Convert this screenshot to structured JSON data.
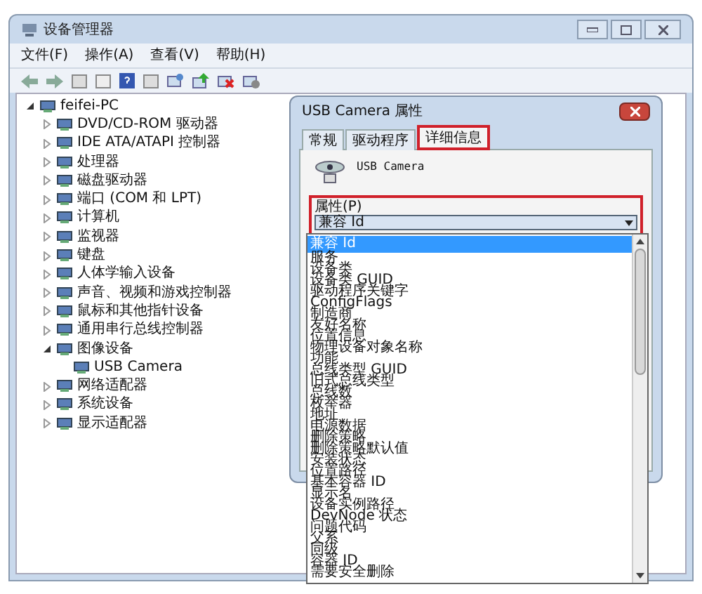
{
  "window": {
    "title": "设备管理器"
  },
  "menu": [
    {
      "label": "文件(F)"
    },
    {
      "label": "操作(A)"
    },
    {
      "label": "查看(V)"
    },
    {
      "label": "帮助(H)"
    }
  ],
  "tree": {
    "label": "feifei-PC",
    "expanded": true,
    "children": [
      {
        "label": "DVD/CD-ROM 驱动器",
        "expanded": false
      },
      {
        "label": "IDE ATA/ATAPI 控制器",
        "expanded": false
      },
      {
        "label": "处理器",
        "expanded": false
      },
      {
        "label": "磁盘驱动器",
        "expanded": false
      },
      {
        "label": "端口 (COM 和 LPT)",
        "expanded": false
      },
      {
        "label": "计算机",
        "expanded": false
      },
      {
        "label": "监视器",
        "expanded": false
      },
      {
        "label": "键盘",
        "expanded": false
      },
      {
        "label": "人体学输入设备",
        "expanded": false
      },
      {
        "label": "声音、视频和游戏控制器",
        "expanded": false
      },
      {
        "label": "鼠标和其他指针设备",
        "expanded": false
      },
      {
        "label": "通用串行总线控制器",
        "expanded": false
      },
      {
        "label": "图像设备",
        "expanded": true,
        "children": [
          {
            "label": "USB Camera"
          }
        ]
      },
      {
        "label": "网络适配器",
        "expanded": false
      },
      {
        "label": "系统设备",
        "expanded": false
      },
      {
        "label": "显示适配器",
        "expanded": false
      }
    ]
  },
  "dialog": {
    "title": "USB Camera 属性",
    "tabs": [
      {
        "label": "常规",
        "selected": false
      },
      {
        "label": "驱动程序",
        "selected": false
      },
      {
        "label": "详细信息",
        "selected": true
      }
    ],
    "device_name": "USB Camera",
    "property_label": "属性(P)",
    "property_value": "兼容 Id",
    "property_options": [
      {
        "label": "兼容 Id",
        "selected": true
      },
      {
        "label": "服务",
        "selected": false
      },
      {
        "label": "设备类",
        "selected": false
      },
      {
        "label": "设备类 GUID",
        "selected": false
      },
      {
        "label": "驱动程序关键字",
        "selected": false
      },
      {
        "label": "ConfigFlags",
        "selected": false
      },
      {
        "label": "制造商",
        "selected": false
      },
      {
        "label": "友好名称",
        "selected": false
      },
      {
        "label": "位置信息",
        "selected": false
      },
      {
        "label": "物理设备对象名称",
        "selected": false
      },
      {
        "label": "功能",
        "selected": false
      },
      {
        "label": "总线类型 GUID",
        "selected": false
      },
      {
        "label": "旧式总线类型",
        "selected": false
      },
      {
        "label": "总线数",
        "selected": false
      },
      {
        "label": "枚举器",
        "selected": false
      },
      {
        "label": "地址",
        "selected": false
      },
      {
        "label": "电源数据",
        "selected": false
      },
      {
        "label": "删除策略",
        "selected": false
      },
      {
        "label": "删除策略默认值",
        "selected": false
      },
      {
        "label": "安装状态",
        "selected": false
      },
      {
        "label": "位置路径",
        "selected": false
      },
      {
        "label": "基本容器 ID",
        "selected": false
      },
      {
        "label": "显示名",
        "selected": false
      },
      {
        "label": "设备实例路径",
        "selected": false
      },
      {
        "label": "DevNode 状态",
        "selected": false
      },
      {
        "label": "问题代码",
        "selected": false
      },
      {
        "label": "父系",
        "selected": false
      },
      {
        "label": "同级",
        "selected": false
      },
      {
        "label": "容器 ID",
        "selected": false
      },
      {
        "label": "需要安全删除",
        "selected": false
      }
    ]
  }
}
